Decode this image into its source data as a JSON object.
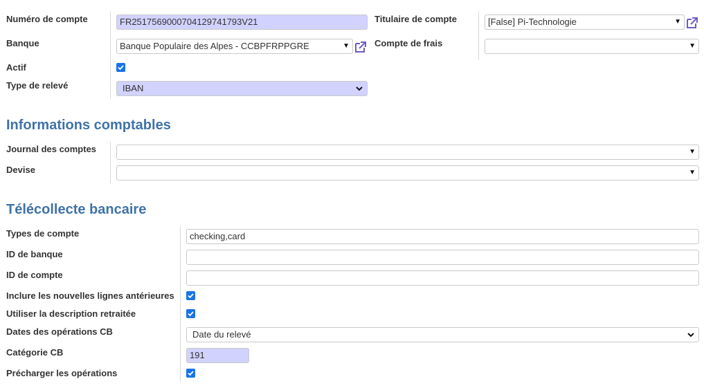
{
  "colors": {
    "accent": "#3f72a8",
    "required_bg": "#d2d2ff",
    "checkbox": "#1a73e8",
    "link_icon": "#6c5cc4"
  },
  "top": {
    "account_number": {
      "label": "Numéro de compte",
      "value": "FR251756900070412974179 3V21"
    },
    "bank": {
      "label": "Banque",
      "value": "Banque Populaire des Alpes - CCBPFRPPGRE"
    },
    "active": {
      "label": "Actif",
      "checked": true
    },
    "statement_type": {
      "label": "Type de relevé",
      "value": "IBAN"
    },
    "holder": {
      "label": "Titulaire de compte",
      "value": "[False] Pi-Technologie"
    },
    "fees_account": {
      "label": "Compte de frais",
      "value": ""
    }
  },
  "accounting": {
    "heading": "Informations comptables",
    "journal": {
      "label": "Journal des comptes",
      "value": ""
    },
    "currency": {
      "label": "Devise",
      "value": ""
    }
  },
  "telecollect": {
    "heading": "Télécollecte bancaire",
    "account_types": {
      "label": "Types de compte",
      "value": "checking,card"
    },
    "bank_id": {
      "label": "ID de banque",
      "value": ""
    },
    "account_id": {
      "label": "ID de compte",
      "value": ""
    },
    "include_old_lines": {
      "label": "Inclure les nouvelles lignes antérieures",
      "checked": true
    },
    "use_processed_desc": {
      "label": "Utiliser la description retraitée",
      "checked": true
    },
    "card_dates": {
      "label": "Dates des opérations CB",
      "value": "Date du relevé"
    },
    "card_category": {
      "label": "Catégorie CB",
      "value": "191"
    },
    "preload_ops": {
      "label": "Précharger les opérations",
      "checked": true
    }
  },
  "icons": {
    "external_link": "external-link-icon",
    "dropdown": "chevron-down-icon",
    "check": "check-icon"
  }
}
